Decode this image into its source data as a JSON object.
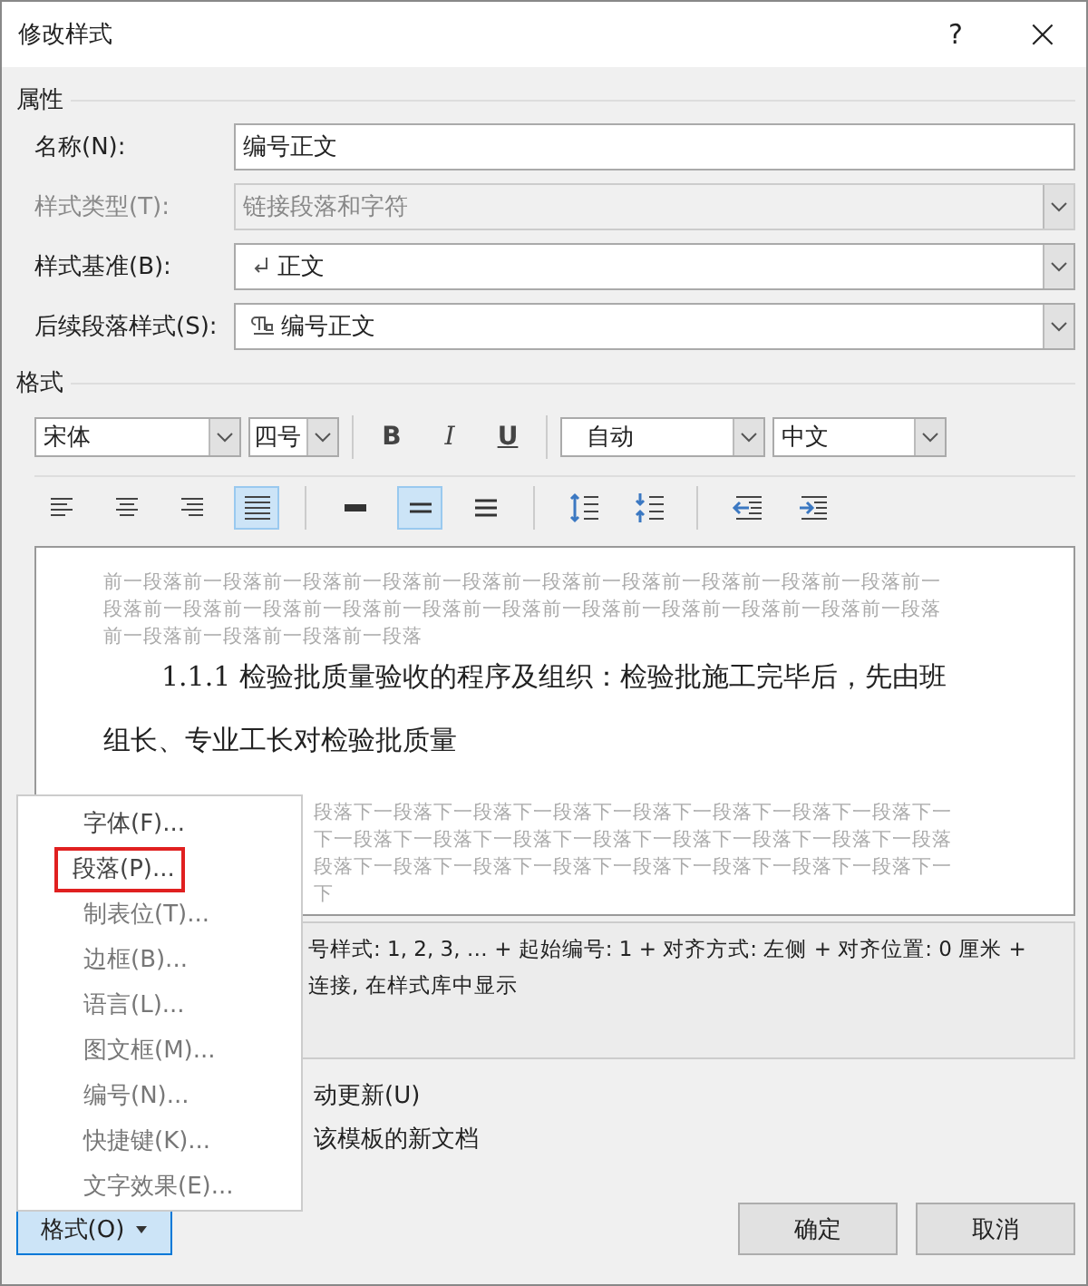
{
  "window": {
    "title": "修改样式",
    "help": "?",
    "close": "×"
  },
  "properties": {
    "heading": "属性",
    "rows": [
      {
        "label": "名称(N):",
        "kind": "text",
        "value": "编号正文",
        "disabled": false
      },
      {
        "label": "样式类型(T):",
        "kind": "combo",
        "value": "链接段落和字符",
        "disabled": true
      },
      {
        "label": "样式基准(B):",
        "kind": "combo-return",
        "value": "正文",
        "disabled": false
      },
      {
        "label": "后续段落样式(S):",
        "kind": "combo-para",
        "value": "编号正文",
        "disabled": false
      }
    ]
  },
  "format": {
    "heading": "格式",
    "font": "宋体",
    "size": "四号",
    "bold": "B",
    "italic": "I",
    "underline": "U",
    "font_color": "自动",
    "script": "中文",
    "align_buttons": [
      {
        "kind": "left",
        "selected": false
      },
      {
        "kind": "center",
        "selected": false
      },
      {
        "kind": "right",
        "selected": false
      },
      {
        "kind": "justify",
        "selected": true
      }
    ],
    "spacing_buttons": [
      {
        "kind": "single",
        "selected": false
      },
      {
        "kind": "onehalf",
        "selected": true
      },
      {
        "kind": "double",
        "selected": false
      }
    ],
    "para_buttons": [
      {
        "kind": "space-more"
      },
      {
        "kind": "space-less"
      }
    ],
    "indent_buttons": [
      {
        "kind": "outdent"
      },
      {
        "kind": "indent"
      }
    ]
  },
  "preview": {
    "before_lines": [
      "前一段落前一段落前一段落前一段落前一段落前一段落前一段落前一段落前一段落前一段落前一",
      "段落前一段落前一段落前一段落前一段落前一段落前一段落前一段落前一段落前一段落前一段落",
      "前一段落前一段落前一段落前一段落"
    ],
    "main_lines": [
      "1.1.1 检验批质量验收的程序及组织：检验批施工完毕后，先由班",
      "组长、专业工长对检验批质量"
    ],
    "after_lines": [
      "段落下一段落下一段落下一段落下一段落下一段落下一段落下一段落下一",
      "下一段落下一段落下一段落下一段落下一段落下一段落下一段落下一段落",
      "段落下一段落下一段落下一段落下一段落下一段落下一段落下一段落下一",
      "下"
    ]
  },
  "description": [
    "号样式: 1, 2, 3, … + 起始编号: 1 + 对齐方式: 左侧 + 对齐位置:  0 厘米 +",
    "连接, 在样式库中显示"
  ],
  "options": [
    "动更新(U)",
    "该模板的新文档"
  ],
  "menu": [
    {
      "label": "字体(F)...",
      "highlighted": false
    },
    {
      "label": "段落(P)...",
      "highlighted": true
    },
    {
      "label": "制表位(T)...",
      "highlighted": false
    },
    {
      "label": "边框(B)...",
      "highlighted": false
    },
    {
      "label": "语言(L)...",
      "highlighted": false
    },
    {
      "label": "图文框(M)...",
      "highlighted": false
    },
    {
      "label": "编号(N)...",
      "highlighted": false
    },
    {
      "label": "快捷键(K)...",
      "highlighted": false
    },
    {
      "label": "文字效果(E)...",
      "highlighted": false
    }
  ],
  "buttons": {
    "format": "格式(O)",
    "ok": "确定",
    "cancel": "取消"
  }
}
